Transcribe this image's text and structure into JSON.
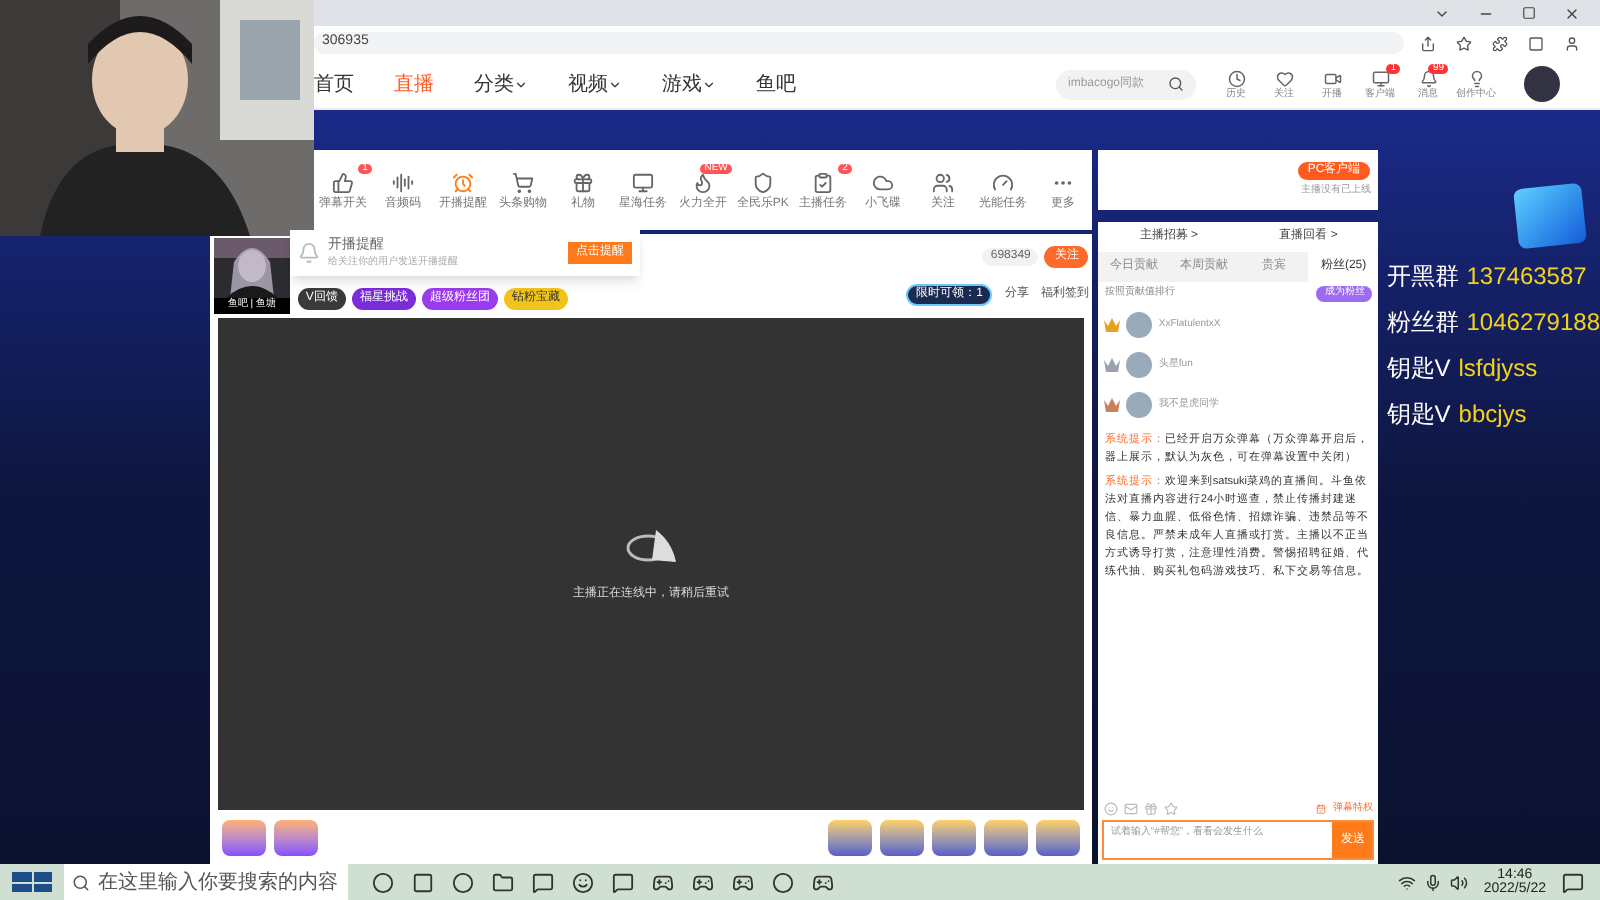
{
  "browser": {
    "address": "306935"
  },
  "nav": {
    "items": [
      {
        "label": "首页",
        "selected": false,
        "caret": false
      },
      {
        "label": "直播",
        "selected": true,
        "caret": false
      },
      {
        "label": "分类",
        "selected": false,
        "caret": true
      },
      {
        "label": "视频",
        "selected": false,
        "caret": true
      },
      {
        "label": "游戏",
        "selected": false,
        "caret": true
      },
      {
        "label": "鱼吧",
        "selected": false,
        "caret": false
      }
    ],
    "search": {
      "placeholder": "imbacogo同款"
    },
    "actions": [
      {
        "label": "历史"
      },
      {
        "label": "关注"
      },
      {
        "label": "开播"
      },
      {
        "label": "客户端",
        "badge": "1"
      },
      {
        "label": "消息",
        "badge": "99"
      },
      {
        "label": "创作中心"
      }
    ]
  },
  "toolbar": {
    "items": [
      {
        "label": "弹幕开关",
        "badge": "1"
      },
      {
        "label": "音频码"
      },
      {
        "label": "开播提醒"
      },
      {
        "label": "头条购物"
      },
      {
        "label": "礼物"
      },
      {
        "label": "星海任务"
      },
      {
        "label": "火力全开",
        "badge": "NEW"
      },
      {
        "label": "全民乐PK"
      },
      {
        "label": "主播任务",
        "badge": "2"
      },
      {
        "label": "小飞碟"
      },
      {
        "label": "关注"
      },
      {
        "label": "光能任务"
      },
      {
        "label": "更多"
      }
    ],
    "client_button": "PC客户端",
    "client_note": "主播没有已上线"
  },
  "reminder": {
    "title": "开播提醒",
    "text": "给关注你的用户发送开播提醒",
    "button": "点击提醒"
  },
  "streamer": {
    "avatar_caption": "鱼吧 | 鱼塘",
    "followers": "698349",
    "follow": "关注",
    "tags": [
      {
        "label": "V回馈",
        "color": "#3a3a3a"
      },
      {
        "label": "福星挑战",
        "color": "#7b2cd9"
      },
      {
        "label": "超级粉丝团",
        "color": "#9b3bef"
      },
      {
        "label": "钻粉宝藏",
        "color": "#f2c41a"
      }
    ],
    "limited": "限时可领：1",
    "share": "分享",
    "checkin": "福利签到"
  },
  "video": {
    "message": "主播正在连线中，请稍后重试"
  },
  "chat": {
    "links": [
      "主播招募 >",
      "直播回看 >"
    ],
    "tabs": [
      {
        "label": "今日贡献",
        "selected": false
      },
      {
        "label": "本周贡献",
        "selected": false
      },
      {
        "label": "贵宾",
        "selected": false
      },
      {
        "label": "粉丝(25)",
        "selected": true
      }
    ],
    "rank_title": "按照贡献值排行",
    "join": "成为粉丝",
    "fans": [
      {
        "name": "XxFlatulentxX",
        "color": "#e8a020"
      },
      {
        "name": "头星fun",
        "color": "#9aa0b0"
      },
      {
        "name": "我不是虎同学",
        "color": "#c9805a"
      }
    ],
    "messages": [
      {
        "label": "系统提示：",
        "text": "已经开启万众弹幕（万众弹幕开启后，器上展示，默认为灰色，可在弹幕设置中关闭）"
      },
      {
        "label": "系统提示：",
        "text": "欢迎来到satsuki菜鸡的直播间。斗鱼依法对直播内容进行24小时巡查，禁止传播封建迷信、暴力血腥、低俗色情、招嫖诈骗、违禁品等不良信息。严禁未成年人直播或打赏。主播以不正当方式诱导打赏，注意理性消费。警惕招聘征婚、代练代抽、购买礼包码游戏技巧、私下交易等信息。"
      }
    ],
    "placeholder": "试着输入“#帮您”，看看会发生什么",
    "send": "发送",
    "barrage": "弹幕特权"
  },
  "overlay": [
    {
      "label": "开黑群",
      "value": "137463587"
    },
    {
      "label": "粉丝群",
      "value": "1046279188"
    },
    {
      "label": "钥匙V",
      "value": "lsfdjyss"
    },
    {
      "label": "钥匙V",
      "value": "bbcjys"
    }
  ],
  "taskbar": {
    "search": "在这里输入你要搜索的内容",
    "time": "14:46",
    "date": "2022/5/22"
  }
}
